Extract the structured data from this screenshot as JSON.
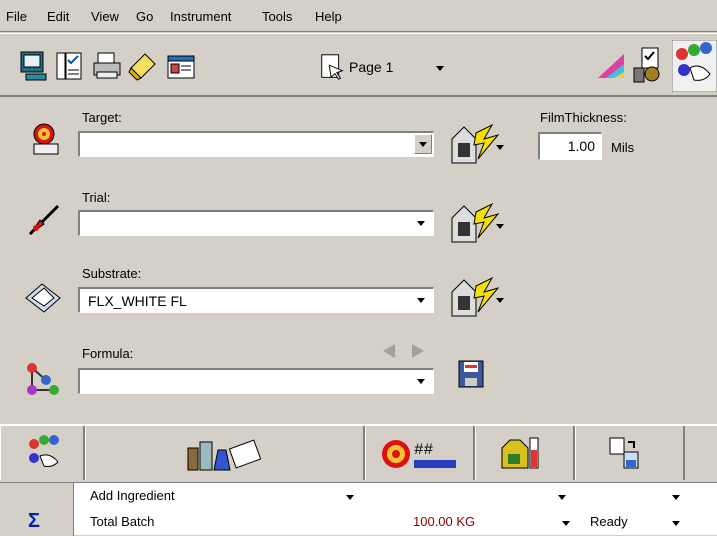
{
  "menu": [
    "File",
    "Edit",
    "View",
    "Go",
    "Instrument",
    "Tools",
    "Help"
  ],
  "toolbar": {
    "page_label": "Page 1",
    "icons": [
      "terminal-icon",
      "checklist-icon",
      "printer-icon",
      "eraser-icon",
      "id-card-icon",
      "page-icon",
      "color-triangle-icon",
      "clipboard-gear-icon",
      "color-dots-icon"
    ]
  },
  "target": {
    "label": "Target:",
    "value": ""
  },
  "trial": {
    "label": "Trial:",
    "value": ""
  },
  "substrate": {
    "label": "Substrate:",
    "value": "FLX_WHITE FL"
  },
  "formula": {
    "label": "Formula:",
    "value": ""
  },
  "film": {
    "label": "FilmThickness:",
    "value": "1.00",
    "unit": "Mils"
  },
  "grid": {
    "rows": [
      {
        "name": "Add Ingredient",
        "amount": "",
        "status": ""
      },
      {
        "name": "Total Batch",
        "amount": "100.00 KG",
        "status": "Ready"
      }
    ]
  },
  "colors": {
    "amount_text": "#8b0000",
    "panel": "#d4d0c8"
  }
}
